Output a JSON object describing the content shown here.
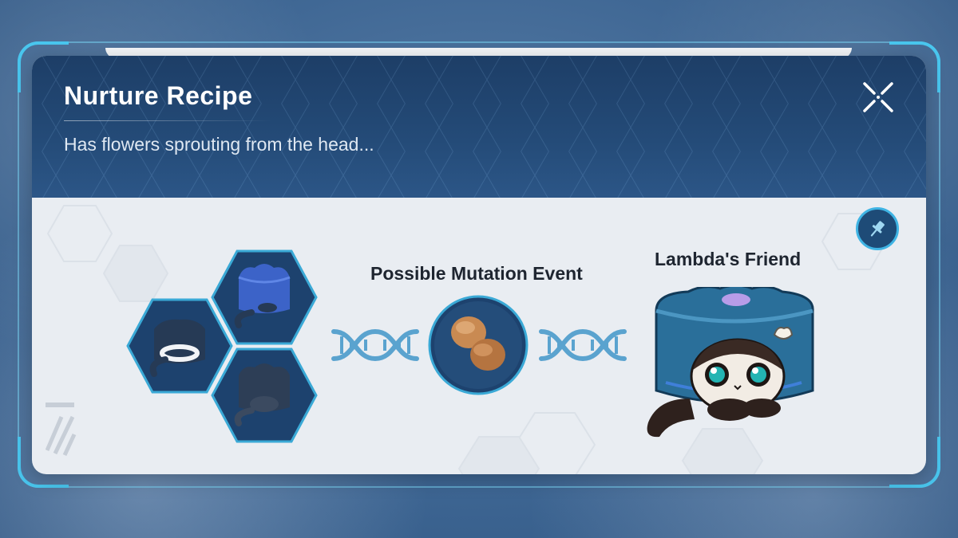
{
  "dialog": {
    "title": "Nurture Recipe",
    "subtitle": "Has flowers sprouting from the head..."
  },
  "recipe": {
    "mutation_label": "Possible Mutation Event",
    "result_label": "Lambda's Friend"
  },
  "icons": {
    "close": "close-icon",
    "pin": "pin-icon",
    "dna": "dna-icon",
    "mutation_item": "seed-pods-icon"
  },
  "colors": {
    "header": "#244b78",
    "accent": "#49c6ee",
    "dna": "#5aa3cf",
    "hex_fill": "#1f4470"
  }
}
